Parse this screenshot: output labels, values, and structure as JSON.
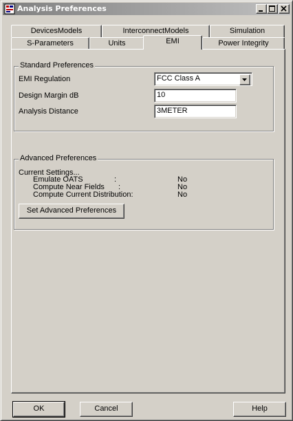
{
  "window": {
    "title": "Analysis Preferences"
  },
  "tabs_top": [
    "DevicesModels",
    "InterconnectModels",
    "Simulation"
  ],
  "tabs_bottom": [
    "S-Parameters",
    "Units",
    "EMI",
    "Power Integrity"
  ],
  "active_tab": "EMI",
  "standard": {
    "title": "Standard Preferences",
    "emi_label": "EMI Regulation",
    "emi_value": "FCC Class A",
    "margin_label": "Design Margin dB",
    "margin_value": "10",
    "distance_label": "Analysis Distance",
    "distance_value": "3METER"
  },
  "advanced": {
    "title": "Advanced Preferences",
    "current": "Current Settings...",
    "rows": [
      {
        "label": "Emulate OATS",
        "sep": ":",
        "value": "No"
      },
      {
        "label": "Compute Near Fields",
        "sep": ":",
        "value": "No"
      },
      {
        "label": "Compute Current Distribution:",
        "sep": "",
        "value": "No"
      }
    ],
    "button": "Set Advanced Preferences"
  },
  "buttons": {
    "ok": "OK",
    "cancel": "Cancel",
    "help": "Help"
  }
}
